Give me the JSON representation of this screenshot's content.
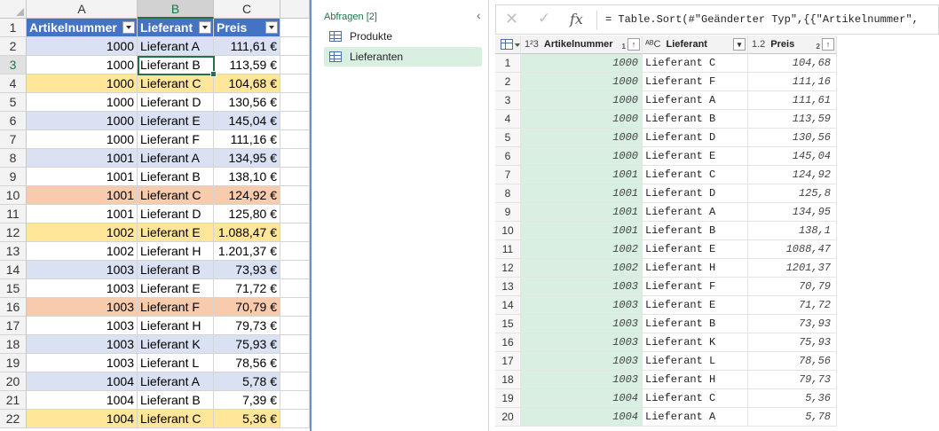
{
  "excel": {
    "columns": [
      "A",
      "B",
      "C"
    ],
    "header_row": {
      "row_num": "1",
      "cells": [
        "Artikelnummer",
        "Lieferant",
        "Preis"
      ]
    },
    "rows": [
      {
        "row_num": "2",
        "artikel": "1000",
        "lieferant": "Lieferant A",
        "preis": "111,61 €",
        "fill": "#d9e1f2"
      },
      {
        "row_num": "3",
        "artikel": "1000",
        "lieferant": "Lieferant B",
        "preis": "113,59 €",
        "fill": "#ffffff"
      },
      {
        "row_num": "4",
        "artikel": "1000",
        "lieferant": "Lieferant C",
        "preis": "104,68 €",
        "fill": "#ffe699"
      },
      {
        "row_num": "5",
        "artikel": "1000",
        "lieferant": "Lieferant D",
        "preis": "130,56 €",
        "fill": "#ffffff"
      },
      {
        "row_num": "6",
        "artikel": "1000",
        "lieferant": "Lieferant E",
        "preis": "145,04 €",
        "fill": "#d9e1f2"
      },
      {
        "row_num": "7",
        "artikel": "1000",
        "lieferant": "Lieferant F",
        "preis": "111,16 €",
        "fill": "#ffffff"
      },
      {
        "row_num": "8",
        "artikel": "1001",
        "lieferant": "Lieferant A",
        "preis": "134,95 €",
        "fill": "#d9e1f2"
      },
      {
        "row_num": "9",
        "artikel": "1001",
        "lieferant": "Lieferant B",
        "preis": "138,10 €",
        "fill": "#ffffff"
      },
      {
        "row_num": "10",
        "artikel": "1001",
        "lieferant": "Lieferant C",
        "preis": "124,92 €",
        "fill": "#f8cbad"
      },
      {
        "row_num": "11",
        "artikel": "1001",
        "lieferant": "Lieferant D",
        "preis": "125,80 €",
        "fill": "#ffffff"
      },
      {
        "row_num": "12",
        "artikel": "1002",
        "lieferant": "Lieferant E",
        "preis": "1.088,47 €",
        "fill": "#ffe699"
      },
      {
        "row_num": "13",
        "artikel": "1002",
        "lieferant": "Lieferant H",
        "preis": "1.201,37 €",
        "fill": "#ffffff"
      },
      {
        "row_num": "14",
        "artikel": "1003",
        "lieferant": "Lieferant B",
        "preis": "73,93 €",
        "fill": "#d9e1f2"
      },
      {
        "row_num": "15",
        "artikel": "1003",
        "lieferant": "Lieferant E",
        "preis": "71,72 €",
        "fill": "#ffffff"
      },
      {
        "row_num": "16",
        "artikel": "1003",
        "lieferant": "Lieferant F",
        "preis": "70,79 €",
        "fill": "#f8cbad"
      },
      {
        "row_num": "17",
        "artikel": "1003",
        "lieferant": "Lieferant H",
        "preis": "79,73 €",
        "fill": "#ffffff"
      },
      {
        "row_num": "18",
        "artikel": "1003",
        "lieferant": "Lieferant K",
        "preis": "75,93 €",
        "fill": "#d9e1f2"
      },
      {
        "row_num": "19",
        "artikel": "1003",
        "lieferant": "Lieferant L",
        "preis": "78,56 €",
        "fill": "#ffffff"
      },
      {
        "row_num": "20",
        "artikel": "1004",
        "lieferant": "Lieferant A",
        "preis": "5,78 €",
        "fill": "#d9e1f2"
      },
      {
        "row_num": "21",
        "artikel": "1004",
        "lieferant": "Lieferant B",
        "preis": "7,39 €",
        "fill": "#ffffff"
      },
      {
        "row_num": "22",
        "artikel": "1004",
        "lieferant": "Lieferant C",
        "preis": "5,36 €",
        "fill": "#ffe699"
      }
    ],
    "selected_cell": "B3"
  },
  "power_query": {
    "queries_title": "Abfragen [2]",
    "collapse_icon": "chevron-left-icon",
    "queries": [
      {
        "label": "Produkte",
        "icon": "table-icon",
        "selected": false
      },
      {
        "label": "Lieferanten",
        "icon": "table-icon",
        "selected": true
      }
    ],
    "formula_bar": {
      "cancel_icon": "✕",
      "confirm_icon": "✓",
      "fx_label": "fx",
      "formula": "= Table.Sort(#\"Geänderter Typ\",{{\"Artikelnummer\","
    },
    "grid": {
      "headers": [
        {
          "type_icon": "1²3",
          "label": "Artikelnummer",
          "sort_order": "1",
          "sort_icon": "↑"
        },
        {
          "type_icon": "ᴬᴮC",
          "label": "Lieferant"
        },
        {
          "type_icon": "1.2",
          "label": "Preis",
          "sort_order": "2",
          "sort_icon": "↑"
        }
      ],
      "rows": [
        {
          "idx": "1",
          "artikel": "1000",
          "lieferant": "Lieferant C",
          "preis": "104,68"
        },
        {
          "idx": "2",
          "artikel": "1000",
          "lieferant": "Lieferant F",
          "preis": "111,16"
        },
        {
          "idx": "3",
          "artikel": "1000",
          "lieferant": "Lieferant A",
          "preis": "111,61"
        },
        {
          "idx": "4",
          "artikel": "1000",
          "lieferant": "Lieferant B",
          "preis": "113,59"
        },
        {
          "idx": "5",
          "artikel": "1000",
          "lieferant": "Lieferant D",
          "preis": "130,56"
        },
        {
          "idx": "6",
          "artikel": "1000",
          "lieferant": "Lieferant E",
          "preis": "145,04"
        },
        {
          "idx": "7",
          "artikel": "1001",
          "lieferant": "Lieferant C",
          "preis": "124,92"
        },
        {
          "idx": "8",
          "artikel": "1001",
          "lieferant": "Lieferant D",
          "preis": "125,8"
        },
        {
          "idx": "9",
          "artikel": "1001",
          "lieferant": "Lieferant A",
          "preis": "134,95"
        },
        {
          "idx": "10",
          "artikel": "1001",
          "lieferant": "Lieferant B",
          "preis": "138,1"
        },
        {
          "idx": "11",
          "artikel": "1002",
          "lieferant": "Lieferant E",
          "preis": "1088,47"
        },
        {
          "idx": "12",
          "artikel": "1002",
          "lieferant": "Lieferant H",
          "preis": "1201,37"
        },
        {
          "idx": "13",
          "artikel": "1003",
          "lieferant": "Lieferant F",
          "preis": "70,79"
        },
        {
          "idx": "14",
          "artikel": "1003",
          "lieferant": "Lieferant E",
          "preis": "71,72"
        },
        {
          "idx": "15",
          "artikel": "1003",
          "lieferant": "Lieferant B",
          "preis": "73,93"
        },
        {
          "idx": "16",
          "artikel": "1003",
          "lieferant": "Lieferant K",
          "preis": "75,93"
        },
        {
          "idx": "17",
          "artikel": "1003",
          "lieferant": "Lieferant L",
          "preis": "78,56"
        },
        {
          "idx": "18",
          "artikel": "1003",
          "lieferant": "Lieferant H",
          "preis": "79,73"
        },
        {
          "idx": "19",
          "artikel": "1004",
          "lieferant": "Lieferant C",
          "preis": "5,36"
        },
        {
          "idx": "20",
          "artikel": "1004",
          "lieferant": "Lieferant A",
          "preis": "5,78"
        }
      ]
    }
  }
}
